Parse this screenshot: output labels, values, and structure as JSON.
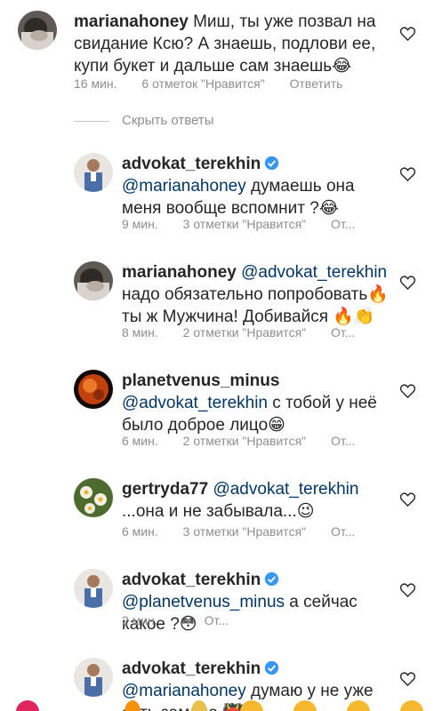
{
  "colors": {
    "text": "#262626",
    "secondary": "#8e8e8e",
    "mention": "#00376b",
    "verified": "#3897f0"
  },
  "top_comment": {
    "username": "marianahoney",
    "text": "Миш, ты уже позвал на свидание Ксю? А знаешь, подлови ее, купи букет и дальше сам знаешь😂",
    "time": "16 мин.",
    "likes": "6 отметок \"Нравится\"",
    "reply": "Ответить",
    "avatar_icon": "profile-photo-icon"
  },
  "hide_replies": "Скрыть ответы",
  "replies": [
    {
      "username": "advokat_terekhin",
      "verified": true,
      "mention": "@marianahoney",
      "text": "думаешь она меня вообще вспомнит ?😂",
      "time": "9 мин.",
      "likes": "3 отметки \"Нравится\"",
      "reply": "От..."
    },
    {
      "username": "marianahoney",
      "verified": false,
      "mention": "@advokat_terekhin",
      "text": "надо обязательно попробовать🔥 ты ж  Мужчина! Добивайся 🔥👏",
      "time": "8 мин.",
      "likes": "2 отметки \"Нравится\"",
      "reply": "От..."
    },
    {
      "username": "planetvenus_minus",
      "verified": false,
      "mention": "@advokat_terekhin",
      "text": "с тобой у неё было доброе лицо😁",
      "time": "6 мин.",
      "likes": "2 отметки \"Нравится\"",
      "reply": "От..."
    },
    {
      "username": "gertryda77",
      "verified": false,
      "mention": "@advokat_terekhin",
      "text": "...она и не забывала...😉",
      "time": "6 мин.",
      "likes": "3 отметки \"Нравится\"",
      "reply": "От..."
    },
    {
      "username": "advokat_terekhin",
      "verified": true,
      "mention": "@planetvenus_minus",
      "text": "а сейчас какое ?😳",
      "time": "2 мин.",
      "likes": "",
      "reply": "От..."
    },
    {
      "username": "advokat_terekhin",
      "verified": true,
      "mention": "@marianahoney",
      "text": "думаю у не уже есть замена 👹",
      "time": "",
      "likes": "",
      "reply": ""
    }
  ]
}
